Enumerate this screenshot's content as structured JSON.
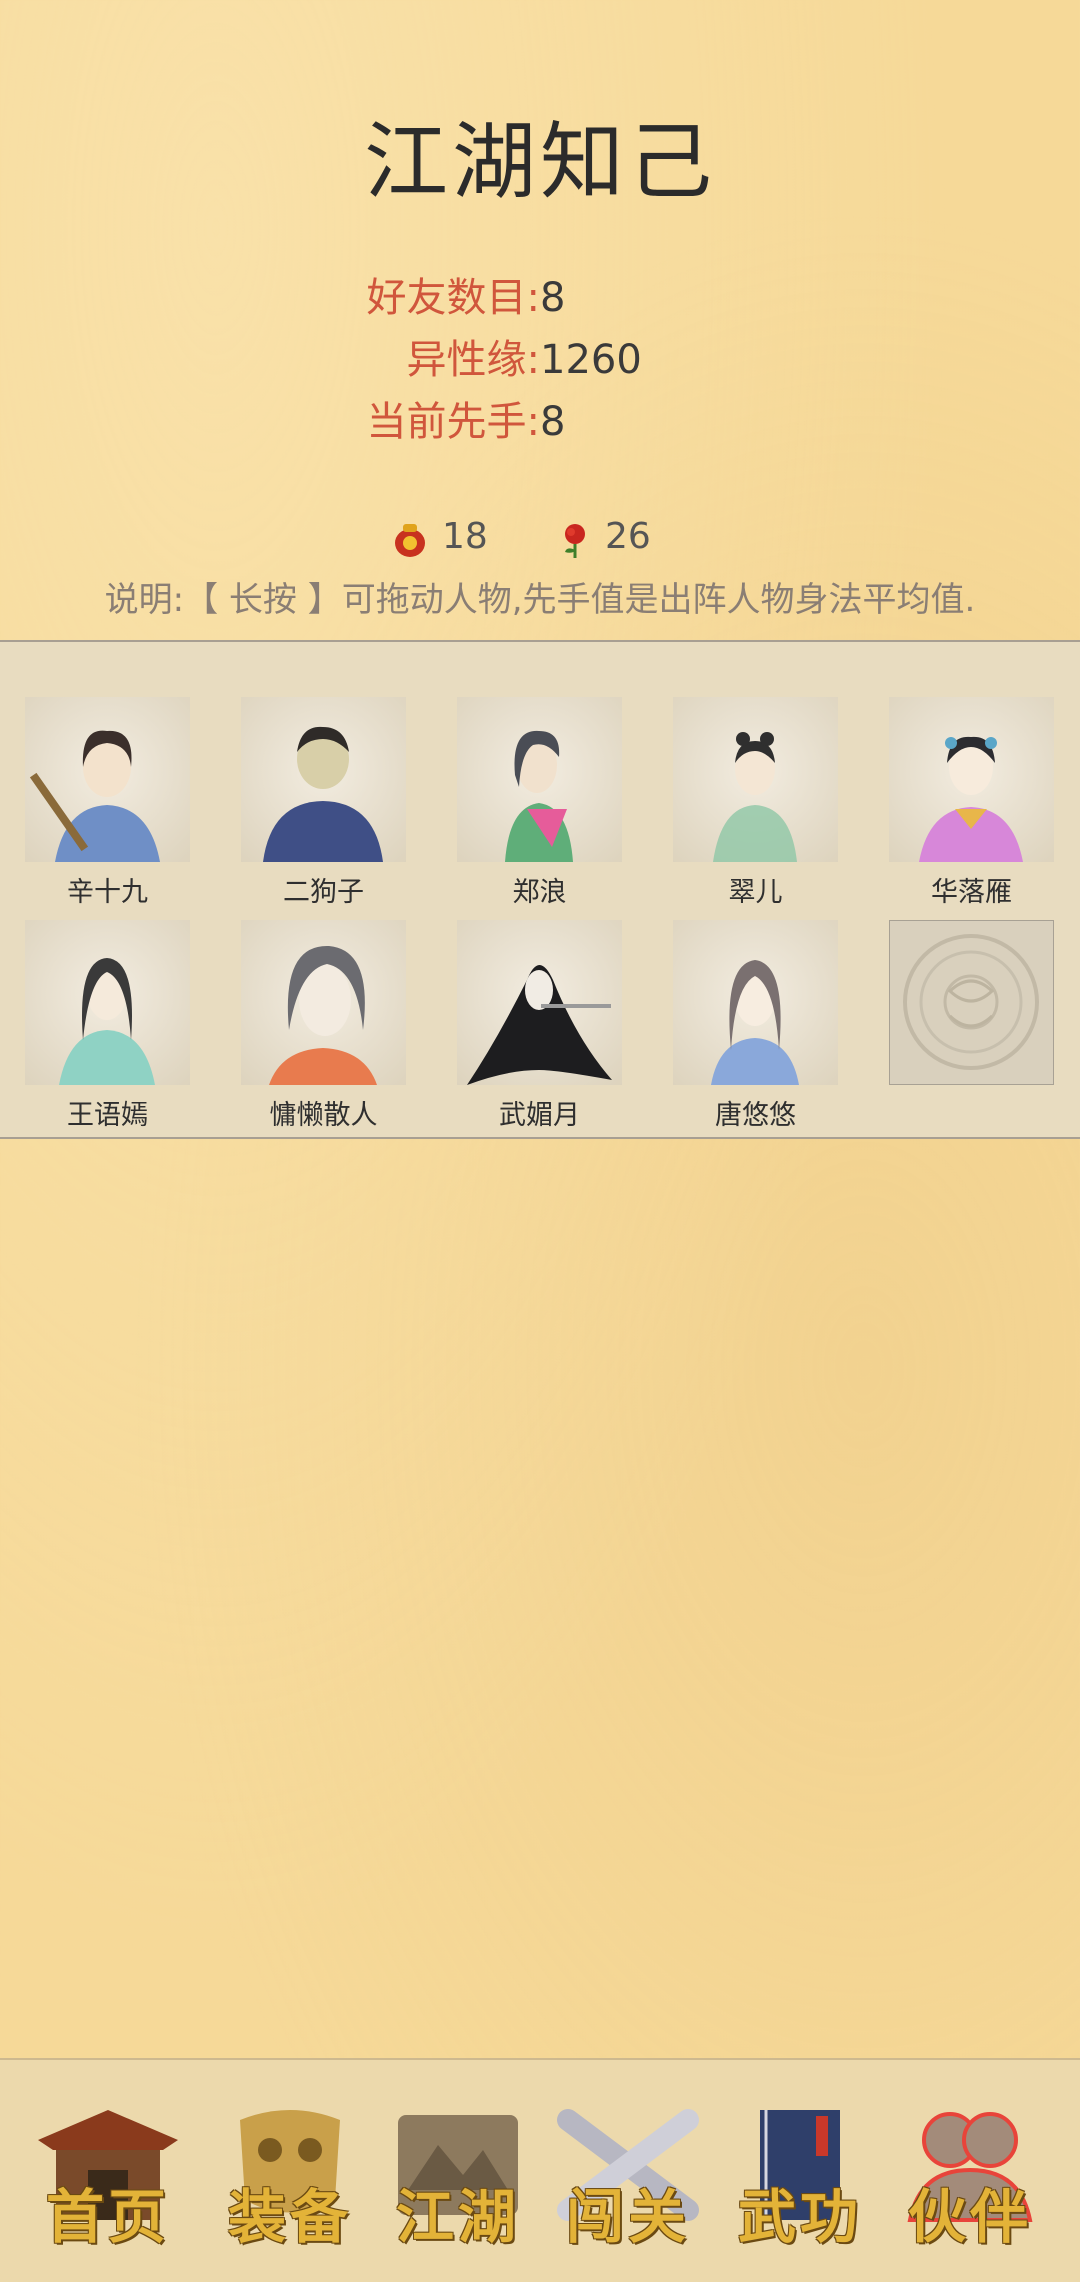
{
  "header": {
    "title": "江湖知己"
  },
  "stats": [
    {
      "label": "好友数目:",
      "value": "8"
    },
    {
      "label": "异性缘:",
      "value": "1260"
    },
    {
      "label": "当前先手:",
      "value": "8"
    }
  ],
  "resources": {
    "jar": {
      "icon": "wine-jar-icon",
      "count": "18"
    },
    "rose": {
      "icon": "rose-icon",
      "count": "26"
    }
  },
  "note": "说明:【 长按 】可拖动人物,先手值是出阵人物身法平均值.",
  "partners": [
    {
      "name": "辛十九"
    },
    {
      "name": "二狗子"
    },
    {
      "name": "郑浪"
    },
    {
      "name": "翠儿"
    },
    {
      "name": "华落雁"
    },
    {
      "name": "王语嫣"
    },
    {
      "name": "慵懒散人"
    },
    {
      "name": "武媚月"
    },
    {
      "name": "唐悠悠"
    }
  ],
  "nav": [
    {
      "label": "首页",
      "icon": "house-icon"
    },
    {
      "label": "装备",
      "icon": "armor-icon"
    },
    {
      "label": "江湖",
      "icon": "scroll-map-icon"
    },
    {
      "label": "闯关",
      "icon": "crossed-swords-icon"
    },
    {
      "label": "武功",
      "icon": "book-icon"
    },
    {
      "label": "伙伴",
      "icon": "partners-icon",
      "active": true
    }
  ],
  "colors": {
    "accent_label": "#d0563c",
    "background": "#f6d998",
    "nav_label": "#e3b338"
  }
}
